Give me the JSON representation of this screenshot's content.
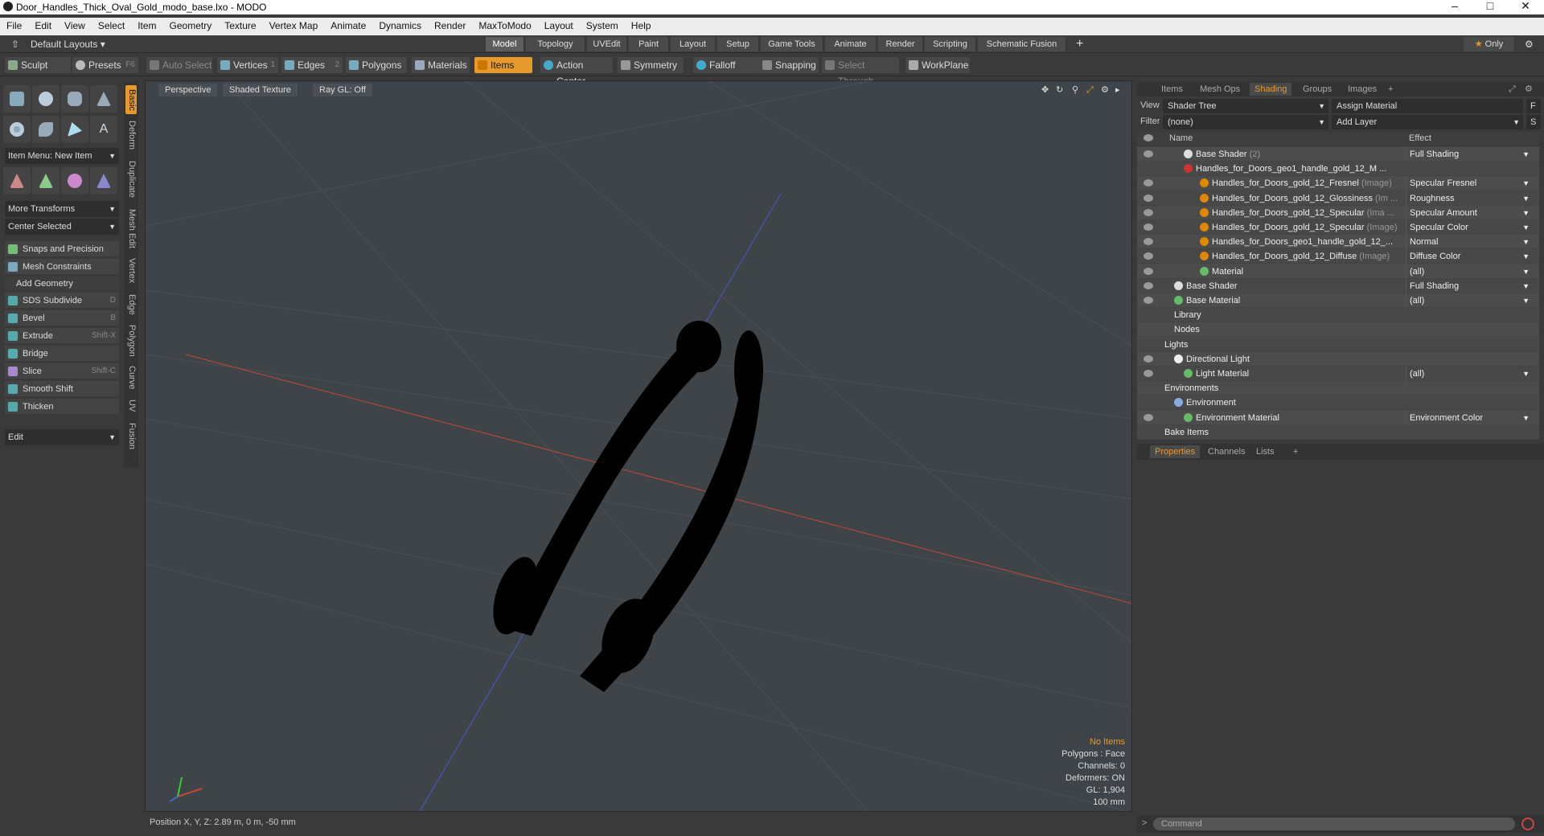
{
  "window": {
    "title": "Door_Handles_Thick_Oval_Gold_modo_base.lxo - MODO"
  },
  "menu": [
    "File",
    "Edit",
    "View",
    "Select",
    "Item",
    "Geometry",
    "Texture",
    "Vertex Map",
    "Animate",
    "Dynamics",
    "Render",
    "MaxToModo",
    "Layout",
    "System",
    "Help"
  ],
  "layout": {
    "preset": "Default Layouts",
    "tabs": [
      "Model",
      "Topology",
      "UVEdit",
      "Paint",
      "Layout",
      "Setup",
      "Game Tools",
      "Animate",
      "Render",
      "Scripting",
      "Schematic Fusion"
    ],
    "active_tab": "Model",
    "only_label": "Only"
  },
  "toolbar": {
    "sculpt": "Sculpt",
    "presets": "Presets",
    "presets_key": "F6",
    "auto_select": "Auto Select",
    "vertices": "Vertices",
    "vertices_key": "1",
    "edges": "Edges",
    "edges_key": "2",
    "polygons": "Polygons",
    "materials": "Materials",
    "items": "Items",
    "action_center": "Action Center",
    "symmetry": "Symmetry",
    "falloff": "Falloff",
    "snapping": "Snapping",
    "select_through": "Select Through",
    "workplane": "WorkPlane"
  },
  "left": {
    "item_menu": "Item Menu: New Item",
    "more_transforms": "More Transforms",
    "center_selected": "Center Selected",
    "snaps": "Snaps and Precision",
    "mesh_constraints": "Mesh Constraints",
    "add_geometry": "Add Geometry",
    "tools": [
      {
        "label": "SDS Subdivide",
        "key": "D"
      },
      {
        "label": "Bevel",
        "key": "B"
      },
      {
        "label": "Extrude",
        "key": "Shift-X"
      },
      {
        "label": "Bridge",
        "key": ""
      },
      {
        "label": "Slice",
        "key": "Shift-C"
      },
      {
        "label": "Smooth Shift",
        "key": ""
      },
      {
        "label": "Thicken",
        "key": ""
      }
    ],
    "edit": "Edit",
    "vtabs": [
      "Basic",
      "Deform",
      "Duplicate",
      "Mesh Edit",
      "Vertex",
      "Edge",
      "Polygon",
      "Curve",
      "UV",
      "Fusion"
    ]
  },
  "viewport": {
    "perspective": "Perspective",
    "shading": "Shaded Texture",
    "raygl": "Ray GL: Off",
    "info": {
      "no_items": "No Items",
      "polygons": "Polygons : Face",
      "channels": "Channels: 0",
      "deformers": "Deformers: ON",
      "gl": "GL: 1,904",
      "scale": "100 mm"
    }
  },
  "status": {
    "position": "Position X, Y, Z:  2.89 m, 0 m, -50 mm"
  },
  "right": {
    "tabs": [
      "Items",
      "Mesh Ops",
      "Shading",
      "Groups",
      "Images"
    ],
    "active_tab": "Shading",
    "view_label": "View",
    "view_value": "Shader Tree",
    "assign_material": "Assign Material",
    "f_button": "F",
    "filter_label": "Filter",
    "filter_value": "(none)",
    "add_layer": "Add Layer",
    "s_button": "S",
    "col_name": "Name",
    "col_effect": "Effect",
    "rows": [
      {
        "name": "Base Shader",
        "suffix": "(2)",
        "effect": "Full Shading",
        "indent": 58,
        "ball": "#ddd"
      },
      {
        "name": "Handles_for_Doors_geo1_handle_gold_12_M  ...",
        "suffix": "",
        "effect": "",
        "indent": 58,
        "ball": "#c33"
      },
      {
        "name": "Handles_for_Doors_gold_12_Fresnel",
        "suffix": "(Image)",
        "effect": "Specular Fresnel",
        "indent": 78,
        "ball": "#d80"
      },
      {
        "name": "Handles_for_Doors_gold_12_Glossiness",
        "suffix": "(Im ...",
        "effect": "Roughness",
        "indent": 78,
        "ball": "#d80"
      },
      {
        "name": "Handles_for_Doors_gold_12_Specular",
        "suffix": "(Ima ...",
        "effect": "Specular Amount",
        "indent": 78,
        "ball": "#d80"
      },
      {
        "name": "Handles_for_Doors_gold_12_Specular",
        "suffix": "(Image)",
        "effect": "Specular Color",
        "indent": 78,
        "ball": "#d80"
      },
      {
        "name": "Handles_for_Doors_geo1_handle_gold_12_...",
        "suffix": "",
        "effect": "Normal",
        "indent": 78,
        "ball": "#d80"
      },
      {
        "name": "Handles_for_Doors_gold_12_Diffuse",
        "suffix": "(Image)",
        "effect": "Diffuse Color",
        "indent": 78,
        "ball": "#d80"
      },
      {
        "name": "Material",
        "suffix": "",
        "effect": "(all)",
        "indent": 78,
        "ball": "#6b6"
      },
      {
        "name": "Base Shader",
        "suffix": "",
        "effect": "Full Shading",
        "indent": 46,
        "ball": "#ddd"
      },
      {
        "name": "Base Material",
        "suffix": "",
        "effect": "(all)",
        "indent": 46,
        "ball": "#6b6"
      },
      {
        "name": "Library",
        "suffix": "",
        "effect": "",
        "indent": 46,
        "ball": ""
      },
      {
        "name": "Nodes",
        "suffix": "",
        "effect": "",
        "indent": 46,
        "ball": ""
      },
      {
        "name": "Lights",
        "suffix": "",
        "effect": "",
        "indent": 34,
        "ball": ""
      },
      {
        "name": "Directional Light",
        "suffix": "",
        "effect": "",
        "indent": 46,
        "ball": "#eee"
      },
      {
        "name": "Light Material",
        "suffix": "",
        "effect": "(all)",
        "indent": 58,
        "ball": "#6b6"
      },
      {
        "name": "Environments",
        "suffix": "",
        "effect": "",
        "indent": 34,
        "ball": ""
      },
      {
        "name": "Environment",
        "suffix": "",
        "effect": "",
        "indent": 46,
        "ball": "#8ad"
      },
      {
        "name": "Environment Material",
        "suffix": "",
        "effect": "Environment Color",
        "indent": 58,
        "ball": "#6b6"
      },
      {
        "name": "Bake Items",
        "suffix": "",
        "effect": "",
        "indent": 34,
        "ball": ""
      }
    ],
    "prop_tabs": [
      "Properties",
      "Channels",
      "Lists"
    ],
    "command_placeholder": "Command"
  },
  "colors": {
    "accent": "#e79a2c",
    "viewport_bg": "#3f4448",
    "axis_x": "#c0483a",
    "axis_z": "#4a5ad0"
  }
}
